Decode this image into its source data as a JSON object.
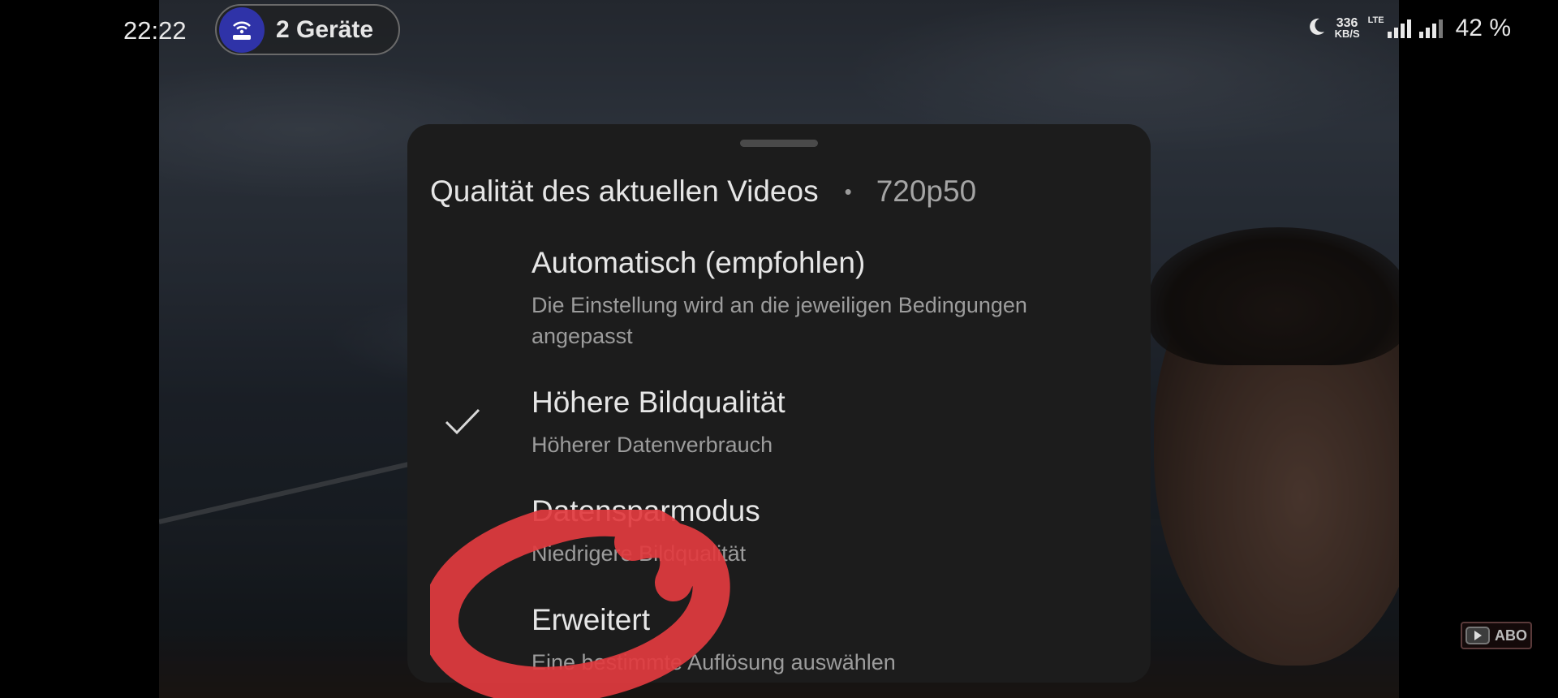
{
  "status_bar": {
    "time": "22:22",
    "devices_label": "2 Geräte",
    "router_icon": "wifi-router-icon",
    "dnd_icon": "moon-icon",
    "speed_value": "336",
    "speed_unit": "KB/S",
    "network_type": "LTE",
    "battery": "42 %"
  },
  "quality_sheet": {
    "header_title": "Qualität des aktuellen Videos",
    "separator": "•",
    "current_quality": "720p50",
    "options": [
      {
        "title": "Automatisch (empfohlen)",
        "description": "Die Einstellung wird an die jeweiligen Bedingungen angepasst",
        "selected": false
      },
      {
        "title": "Höhere Bildqualität",
        "description": "Höherer Datenverbrauch",
        "selected": true
      },
      {
        "title": "Datensparmodus",
        "description": "Niedrigere Bildqualität",
        "selected": false
      },
      {
        "title": "Erweitert",
        "description": "Eine bestimmte Auflösung auswählen",
        "selected": false
      }
    ]
  },
  "subscribe_watermark": {
    "label": "ABO",
    "icon": "youtube-play-icon"
  },
  "colors": {
    "sheet_background": "#1c1c1c",
    "router_circle": "#2f33a8",
    "annotation_red": "#e23b3f"
  }
}
